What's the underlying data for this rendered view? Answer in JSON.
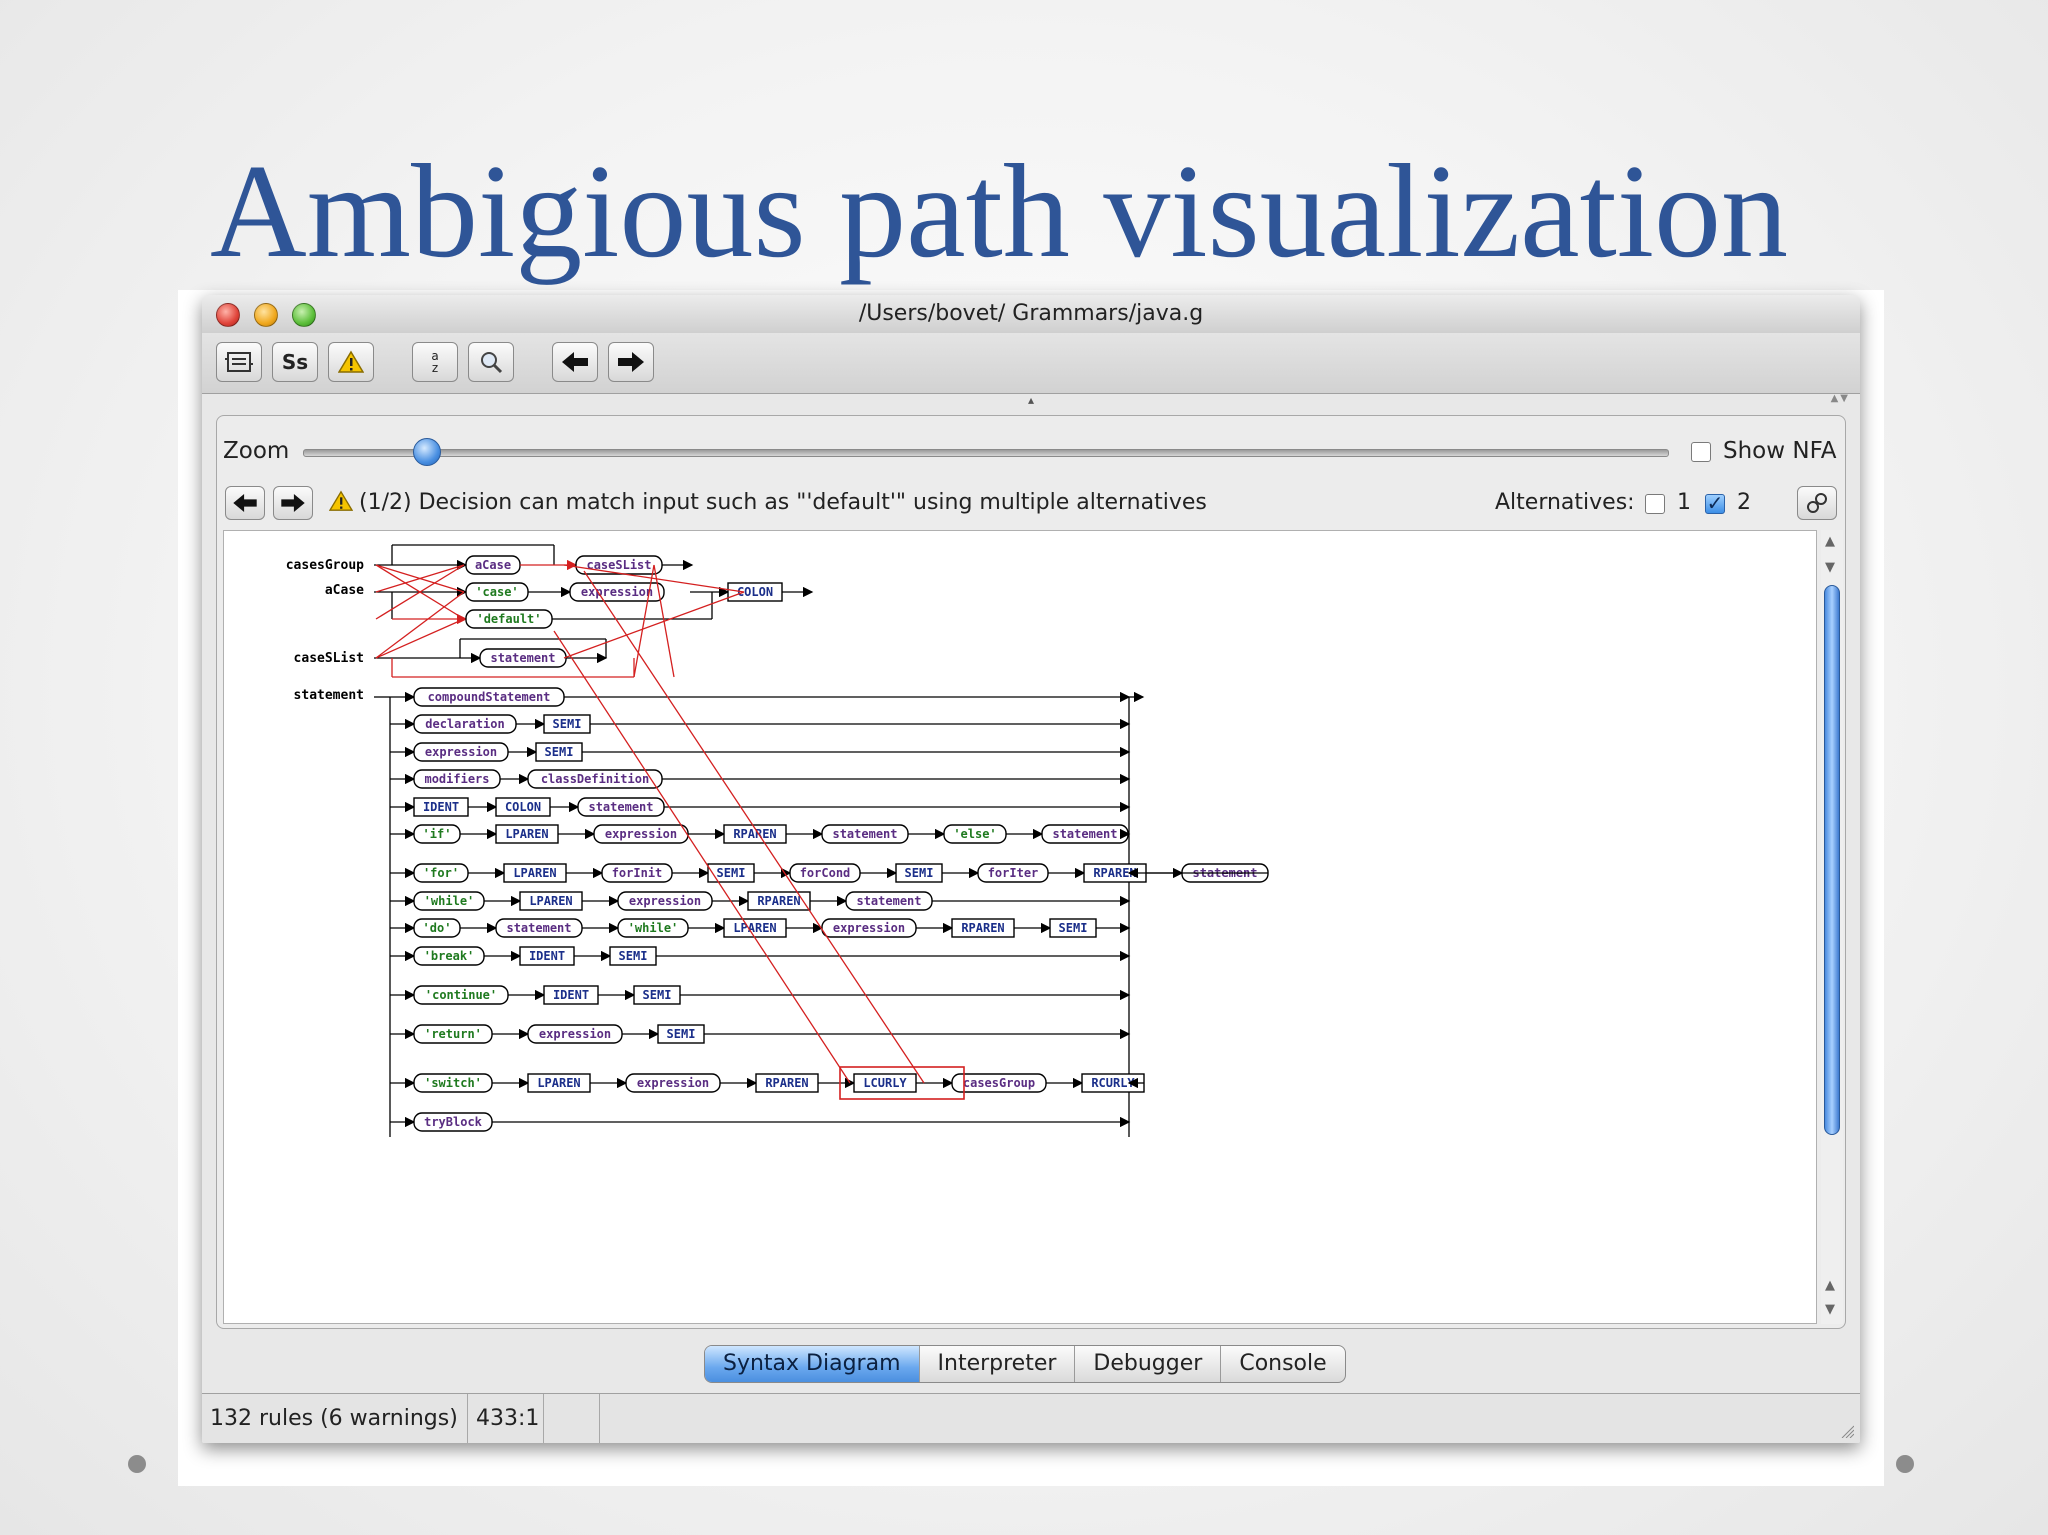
{
  "slide": {
    "title": "Ambigious path visualization"
  },
  "window": {
    "title": "/Users/bovet/ Grammars/java.g"
  },
  "toolbar": {
    "buttons": [
      "rules-icon",
      "case-sensitive-icon",
      "warning-icon",
      "sort-az-icon",
      "find-icon",
      "back-arrow-icon",
      "forward-arrow-icon"
    ],
    "ss_label": "Ss",
    "sort_top": "a",
    "sort_bottom": "z"
  },
  "zoom": {
    "label": "Zoom",
    "value": 0.09
  },
  "show_nfa": {
    "label": "Show NFA",
    "checked": false
  },
  "warning": {
    "message": "(1/2) Decision can match input such as \"'default'\" using multiple alternatives"
  },
  "alternatives": {
    "label": "Alternatives:",
    "alt1_label": "1",
    "alt1_checked": false,
    "alt2_label": "2",
    "alt2_checked": true
  },
  "diagram": {
    "rule_labels": {
      "casesGroup": "casesGroup",
      "aCase": "aCase",
      "caseSList": "caseSList",
      "statement": "statement"
    },
    "casesGroup_nodes": {
      "aCase": "aCase",
      "caseSList": "caseSList"
    },
    "aCase_nodes": {
      "case_kw": "'case'",
      "expression": "expression",
      "colon": "COLON",
      "default_kw": "'default'"
    },
    "caseSList_nodes": {
      "statement": "statement"
    },
    "statement_rows": [
      [
        "compoundStatement"
      ],
      [
        "declaration",
        "SEMI"
      ],
      [
        "expression",
        "SEMI"
      ],
      [
        "modifiers",
        "classDefinition"
      ],
      [
        "IDENT",
        "COLON",
        "statement"
      ],
      [
        "'if'",
        "LPAREN",
        "expression",
        "RPAREN",
        "statement",
        "'else'",
        "statement"
      ],
      [
        "'for'",
        "LPAREN",
        "forInit",
        "SEMI",
        "forCond",
        "SEMI",
        "forIter",
        "RPAREN",
        "statement"
      ],
      [
        "'while'",
        "LPAREN",
        "expression",
        "RPAREN",
        "statement"
      ],
      [
        "'do'",
        "statement",
        "'while'",
        "LPAREN",
        "expression",
        "RPAREN",
        "SEMI"
      ],
      [
        "'break'",
        "IDENT",
        "SEMI"
      ],
      [
        "'continue'",
        "IDENT",
        "SEMI"
      ],
      [
        "'return'",
        "expression",
        "SEMI"
      ],
      [
        "'switch'",
        "LPAREN",
        "expression",
        "RPAREN",
        "LCURLY",
        "casesGroup",
        "RCURLY"
      ],
      [
        "tryBlock"
      ]
    ],
    "colors": {
      "rule_node": "#5a2d82",
      "terminal_node": "#1b2f8a",
      "literal_node": "#1f7a1f",
      "ambiguous_path": "#d42020",
      "line": "#000000"
    }
  },
  "tabs": [
    {
      "label": "Syntax Diagram",
      "active": true
    },
    {
      "label": "Interpreter",
      "active": false
    },
    {
      "label": "Debugger",
      "active": false
    },
    {
      "label": "Console",
      "active": false
    }
  ],
  "status": {
    "rules": "132 rules (6 warnings)",
    "position": "433:1"
  }
}
